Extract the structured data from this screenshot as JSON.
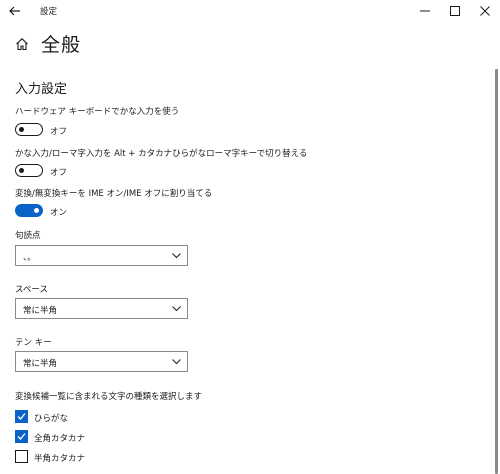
{
  "window": {
    "title": "設定"
  },
  "page": {
    "title": "全般"
  },
  "section": {
    "title": "入力設定"
  },
  "settings": {
    "hardware_keyboard": {
      "label": "ハードウェア キーボードでかな入力を使う",
      "state_label": "オフ",
      "on": false
    },
    "kana_romaji_switch": {
      "label": "かな入力/ローマ字入力を Alt + カタカナひらがなローマ字キーで切り替える",
      "state_label": "オフ",
      "on": false
    },
    "henkan_keys": {
      "label": "変換/無変換キーを IME オン/IME オフに割り当てる",
      "state_label": "オン",
      "on": true
    }
  },
  "dropdowns": {
    "punctuation": {
      "label": "句読点",
      "value": "、。"
    },
    "space": {
      "label": "スペース",
      "value": "常に半角"
    },
    "tenkey": {
      "label": "テン キー",
      "value": "常に半角"
    }
  },
  "candidates": {
    "label": "変換候補一覧に含まれる文字の種類を選択します",
    "items": [
      {
        "label": "ひらがな",
        "checked": true
      },
      {
        "label": "全角カタカナ",
        "checked": true
      },
      {
        "label": "半角カタカナ",
        "checked": false
      }
    ]
  },
  "icons": {
    "back": "back-arrow-icon",
    "home": "home-icon",
    "minimize": "minimize-icon",
    "maximize": "maximize-icon",
    "close": "close-icon",
    "chevron": "chevron-down-icon",
    "check": "checkmark-icon"
  },
  "colors": {
    "accent": "#0a64c8",
    "text": "#1a1a1a",
    "background": "#ffffff"
  }
}
